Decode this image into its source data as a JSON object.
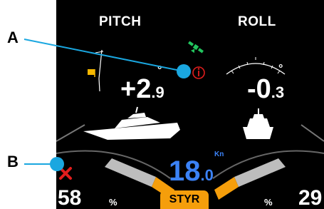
{
  "callouts": {
    "a": "A",
    "b": "B"
  },
  "pitch": {
    "label": "PITCH",
    "value_main": "+2",
    "value_decimal": ".9",
    "degree": "°"
  },
  "roll": {
    "label": "ROLL",
    "value_main": "-0",
    "value_decimal": ".3",
    "degree": "°"
  },
  "speed": {
    "value_main": "18",
    "value_decimal": ".0",
    "unit": "Kn"
  },
  "trim": {
    "left": {
      "value": "58",
      "symbol": "%"
    },
    "right": {
      "value": "29",
      "symbol": "%"
    }
  },
  "mode_badge": "STYR",
  "colors": {
    "background": "#000000",
    "callout_line": "#1aa7e0",
    "speed": "#3b82f6",
    "badge": "#f59e0b",
    "warning": "#e11d1d",
    "gps": "#22c55e",
    "flag": "#f5b700"
  },
  "icons": {
    "info": "info-warning-icon",
    "gps": "satellite-icon",
    "error": "x-error-icon",
    "flag": "flag-marker-icon"
  }
}
